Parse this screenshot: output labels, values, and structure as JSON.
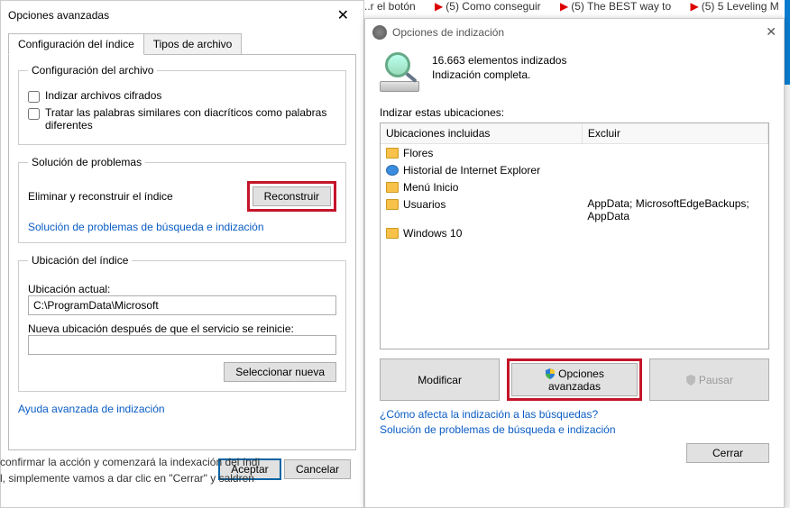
{
  "bg": {
    "tabs": [
      "..r el botón",
      "(5) Como conseguir",
      "(5) The BEST way to",
      "(5) 5 Leveling M"
    ],
    "para1": "confirmar la acción y comenzará la indexación del índi",
    "para2": "l, simplemente vamos a dar clic en \"Cerrar\" y saldren"
  },
  "left": {
    "title": "Opciones avanzadas",
    "tabs": {
      "t1": "Configuración del índice",
      "t2": "Tipos de archivo"
    },
    "group_file": {
      "legend": "Configuración del archivo",
      "cb1": "Indizar archivos cifrados",
      "cb2": "Tratar las palabras similares con diacríticos como palabras diferentes"
    },
    "group_trouble": {
      "legend": "Solución de problemas",
      "row_label": "Eliminar y reconstruir el índice",
      "btn": "Reconstruir",
      "link": "Solución de problemas de búsqueda e indización"
    },
    "group_loc": {
      "legend": "Ubicación del índice",
      "curr_label": "Ubicación actual:",
      "curr_value": "C:\\ProgramData\\Microsoft",
      "new_label": "Nueva ubicación después de que el servicio se reinicie:",
      "new_value": "",
      "btn": "Seleccionar nueva"
    },
    "help_link": "Ayuda avanzada de indización",
    "ok": "Aceptar",
    "cancel": "Cancelar"
  },
  "right": {
    "title": "Opciones de indización",
    "status1": "16.663 elementos indizados",
    "status2": "Indización completa.",
    "sec_label": "Indizar estas ubicaciones:",
    "col1": "Ubicaciones incluidas",
    "col2": "Excluir",
    "rows": [
      {
        "name": "Flores",
        "ex": ""
      },
      {
        "name": "Historial de Internet Explorer",
        "ex": "",
        "ie": true
      },
      {
        "name": "Menú Inicio",
        "ex": ""
      },
      {
        "name": "Usuarios",
        "ex": "AppData; MicrosoftEdgeBackups; AppData"
      },
      {
        "name": "Windows 10",
        "ex": ""
      }
    ],
    "btn_mod": "Modificar",
    "btn_adv": "Opciones avanzadas",
    "btn_pause": "Pausar",
    "link1": "¿Cómo afecta la indización a las búsquedas?",
    "link2": "Solución de problemas de búsqueda e indización",
    "close": "Cerrar"
  }
}
